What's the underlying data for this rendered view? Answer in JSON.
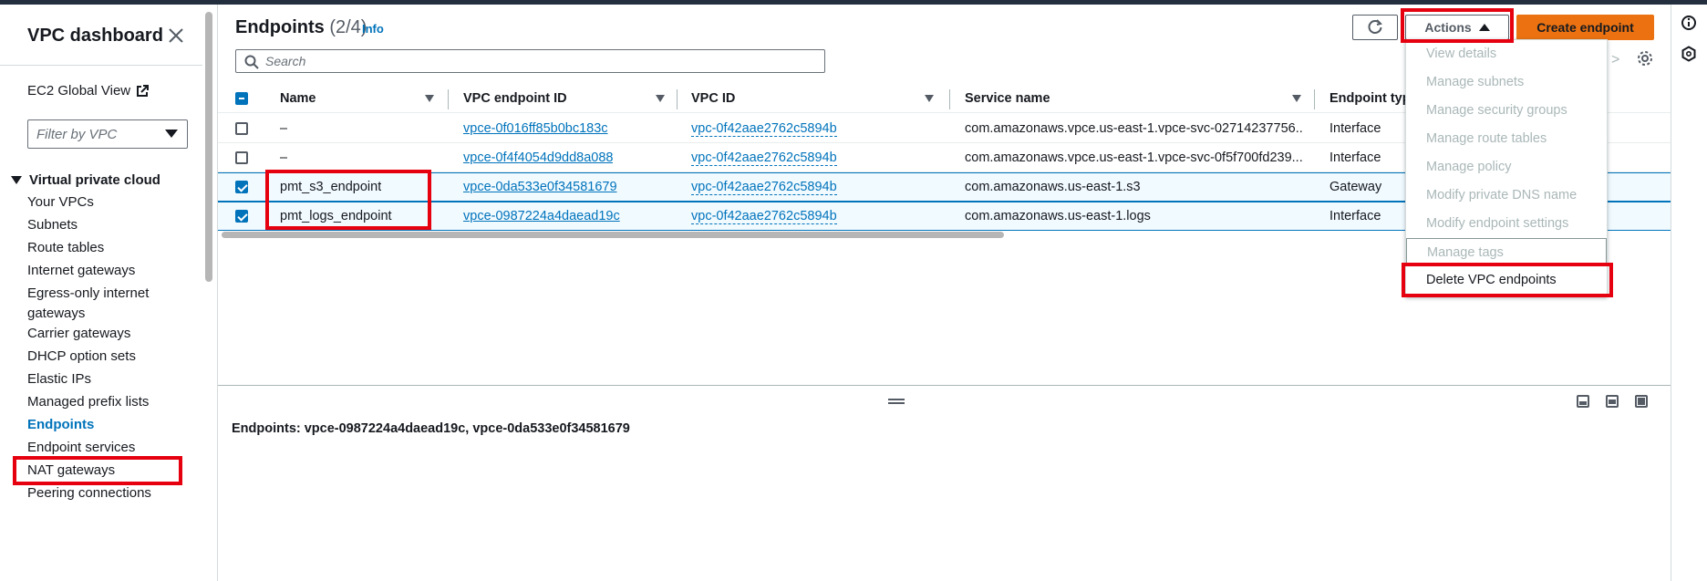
{
  "sidebar": {
    "title": "VPC dashboard",
    "ec2_global_view": "EC2 Global View",
    "filter_placeholder": "Filter by VPC",
    "section": "Virtual private cloud",
    "items": [
      {
        "label": "Your VPCs"
      },
      {
        "label": "Subnets"
      },
      {
        "label": "Route tables"
      },
      {
        "label": "Internet gateways"
      },
      {
        "label": "Egress-only internet gateways"
      },
      {
        "label": "Carrier gateways"
      },
      {
        "label": "DHCP option sets"
      },
      {
        "label": "Elastic IPs"
      },
      {
        "label": "Managed prefix lists"
      },
      {
        "label": "Endpoints"
      },
      {
        "label": "Endpoint services"
      },
      {
        "label": "NAT gateways"
      },
      {
        "label": "Peering connections"
      }
    ],
    "active_item": "Endpoints"
  },
  "header": {
    "title": "Endpoints",
    "count": "(2/4)",
    "info": "Info",
    "actions_label": "Actions",
    "create_label": "Create endpoint",
    "search_placeholder": "Search",
    "pager_next": ">"
  },
  "table": {
    "columns": [
      "Name",
      "VPC endpoint ID",
      "VPC ID",
      "Service name",
      "Endpoint type"
    ],
    "rows": [
      {
        "name": "–",
        "endpoint_id": "vpce-0f016ff85b0bc183c",
        "vpc_id": "vpc-0f42aae2762c5894b",
        "service": "com.amazonaws.vpce.us-east-1.vpce-svc-02714237756...",
        "type": "Interface",
        "selected": false
      },
      {
        "name": "–",
        "endpoint_id": "vpce-0f4f4054d9dd8a088",
        "vpc_id": "vpc-0f42aae2762c5894b",
        "service": "com.amazonaws.vpce.us-east-1.vpce-svc-0f5f700fd239...",
        "type": "Interface",
        "selected": false
      },
      {
        "name": "pmt_s3_endpoint",
        "endpoint_id": "vpce-0da533e0f34581679",
        "vpc_id": "vpc-0f42aae2762c5894b",
        "service": "com.amazonaws.us-east-1.s3",
        "type": "Gateway",
        "selected": true
      },
      {
        "name": "pmt_logs_endpoint",
        "endpoint_id": "vpce-0987224a4daead19c",
        "vpc_id": "vpc-0f42aae2762c5894b",
        "service": "com.amazonaws.us-east-1.logs",
        "type": "Interface",
        "selected": true
      }
    ]
  },
  "details": {
    "text": "Endpoints: vpce-0987224a4daead19c, vpce-0da533e0f34581679"
  },
  "actions_menu": {
    "items": [
      {
        "label": "View details",
        "enabled": false
      },
      {
        "label": "Manage subnets",
        "enabled": false
      },
      {
        "label": "Manage security groups",
        "enabled": false
      },
      {
        "label": "Manage route tables",
        "enabled": false
      },
      {
        "label": "Manage policy",
        "enabled": false
      },
      {
        "label": "Modify private DNS name",
        "enabled": false
      },
      {
        "label": "Modify endpoint settings",
        "enabled": false
      },
      {
        "label": "Manage tags",
        "enabled": false
      },
      {
        "label": "Delete VPC endpoints",
        "enabled": true
      }
    ]
  },
  "colors": {
    "primary_button": "#ec7211",
    "link": "#0073bb",
    "highlight": "#e6000f",
    "topbar": "#232f3e"
  }
}
